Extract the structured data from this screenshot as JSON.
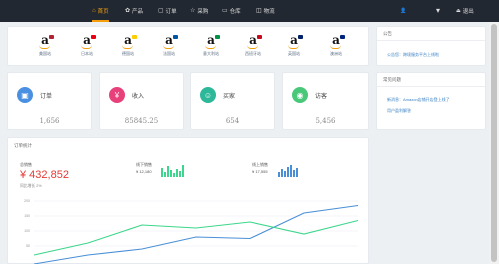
{
  "nav": {
    "items": [
      {
        "icon": "⌂",
        "label": "首页"
      },
      {
        "icon": "✿",
        "label": "产品"
      },
      {
        "icon": "▢",
        "label": "订单"
      },
      {
        "icon": "☆",
        "label": "采购"
      },
      {
        "icon": "▭",
        "label": "仓库"
      },
      {
        "icon": "◫",
        "label": "物流"
      }
    ],
    "user_icon": "👤",
    "dropdown_icon": "▾",
    "logout_label": "退出"
  },
  "marketplaces": [
    {
      "label": "美国站",
      "flag_color": "#b22234"
    },
    {
      "label": "日本站",
      "flag_color": "#e60012"
    },
    {
      "label": "德国站",
      "flag_color": "#ffce00"
    },
    {
      "label": "法国站",
      "flag_color": "#0055a4"
    },
    {
      "label": "意大利站",
      "flag_color": "#009246"
    },
    {
      "label": "西班牙站",
      "flag_color": "#c60b1e"
    },
    {
      "label": "英国站",
      "flag_color": "#012169"
    },
    {
      "label": "澳洲站",
      "flag_color": "#00247d"
    }
  ],
  "stats": [
    {
      "label": "订单",
      "value": "1,656",
      "color": "#4a90e2"
    },
    {
      "label": "收入",
      "value": "85845.25",
      "color": "#e8407a"
    },
    {
      "label": "买家",
      "value": "654",
      "color": "#2eb89a"
    },
    {
      "label": "访客",
      "value": "5,456",
      "color": "#49c87a"
    }
  ],
  "announcement": {
    "title": "公告",
    "links": [
      "公告您：跨境服务平台上线啦"
    ]
  },
  "faq": {
    "title": "常见问题",
    "links": [
      "新消息：Amazon店铺开店登上线了",
      "用户盈利解答"
    ]
  },
  "orders": {
    "title": "订单统计",
    "total_label": "总销售",
    "total_value": "¥ 432,852",
    "growth": "同比增长 2%",
    "offline_label": "线下销售",
    "offline_value": "¥ 12,180",
    "online_label": "线上销售",
    "online_value": "¥ 17,555"
  },
  "chart_data": {
    "type": "line",
    "x": [
      1,
      2,
      3,
      4,
      5,
      6,
      7
    ],
    "ylim": [
      0,
      200
    ],
    "yticks": [
      "50",
      "100",
      "150",
      "200"
    ],
    "series": [
      {
        "name": "",
        "color": "#4a8fd6",
        "values": [
          -10,
          20,
          40,
          80,
          75,
          160,
          185
        ]
      },
      {
        "name": "",
        "color": "#3dd68c",
        "values": [
          20,
          60,
          120,
          110,
          130,
          90,
          135
        ]
      }
    ]
  }
}
